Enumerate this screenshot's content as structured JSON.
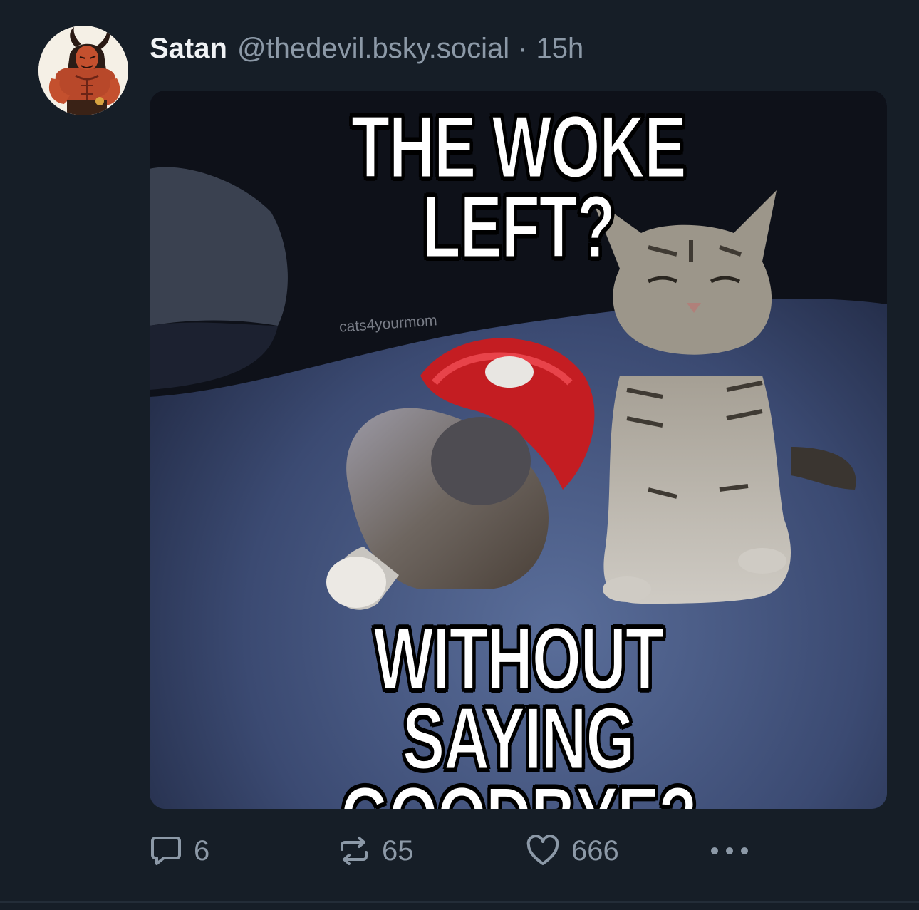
{
  "post": {
    "author": {
      "display_name": "Satan",
      "handle": "@thedevil.bsky.social",
      "avatar_icon": "devil-avatar"
    },
    "separator": "·",
    "timestamp": "15h",
    "image": {
      "top_text": "THE WOKE LEFT?",
      "bottom_text": "WITHOUT SAYING GOODBYE?",
      "watermark": "cats4yourmom"
    },
    "actions": {
      "reply": {
        "icon": "reply-icon",
        "count": "6"
      },
      "repost": {
        "icon": "repost-icon",
        "count": "65"
      },
      "like": {
        "icon": "heart-icon",
        "count": "666"
      },
      "more": {
        "icon": "more-icon"
      }
    }
  },
  "colors": {
    "background": "#161e27",
    "primary_text": "#f1f3f5",
    "secondary_text": "#8c99a7"
  }
}
